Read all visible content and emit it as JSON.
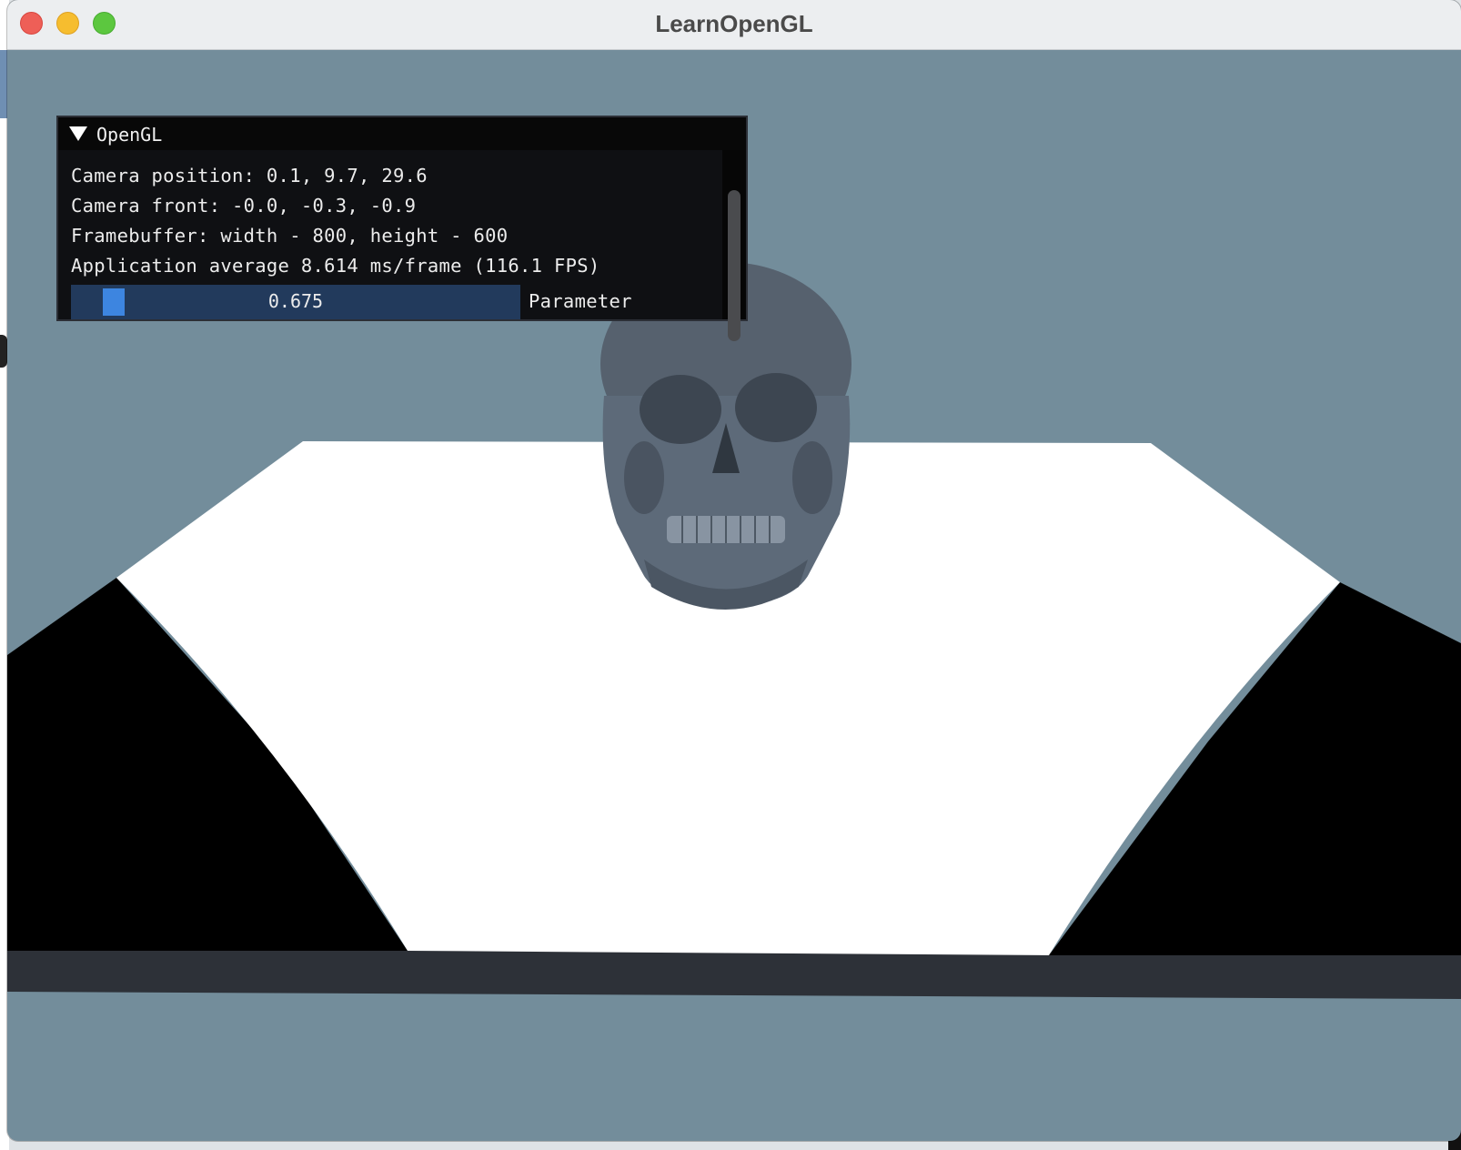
{
  "window": {
    "title": "LearnOpenGL"
  },
  "imgui": {
    "title": "OpenGL",
    "lines": [
      "Camera position: 0.1, 9.7, 29.6",
      "Camera front: -0.0, -0.3, -0.9",
      "Framebuffer: width - 800, height - 600",
      "Application average 8.614 ms/frame (116.1 FPS)"
    ],
    "slider": {
      "value": 0.675,
      "value_text": "0.675",
      "label": "Parameter"
    }
  },
  "colors": {
    "clear_color": "#738d9b",
    "plane": "#ffffff",
    "slider_bg": "#223a5c",
    "slider_grab": "#3d85e0",
    "skull": "#5d6b7b"
  },
  "icons": {
    "collapse": "triangle-down-icon",
    "close": "red-traffic-light",
    "minimize": "yellow-traffic-light",
    "zoom": "green-traffic-light"
  }
}
